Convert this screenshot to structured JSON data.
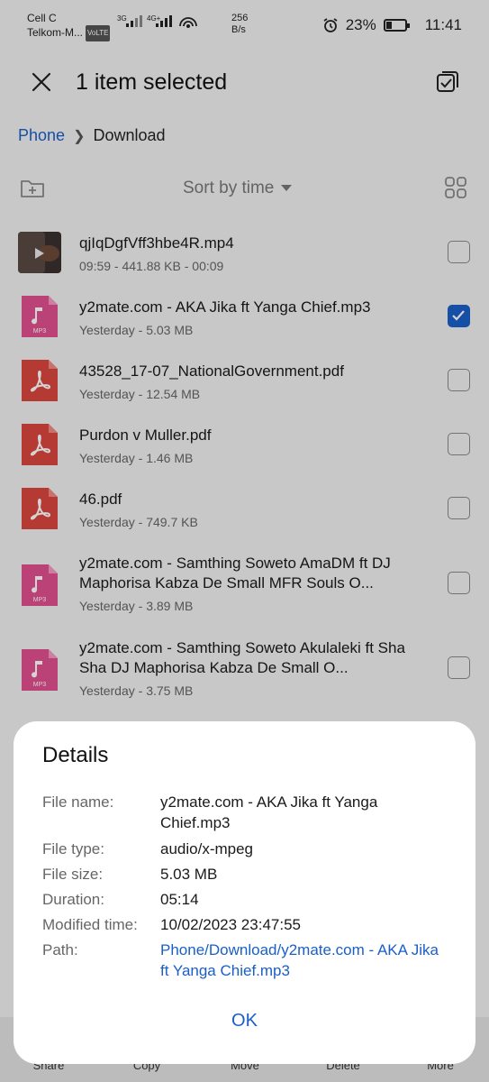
{
  "status_bar": {
    "carrier_line1": "Cell C",
    "carrier_line2": "Telkom-M...",
    "volte": "VoLTE",
    "net1": "3G",
    "net2": "4G+",
    "speed_value": "256",
    "speed_unit": "B/s",
    "battery": "23%",
    "time": "11:41"
  },
  "header": {
    "title": "1 item selected"
  },
  "breadcrumb": {
    "root": "Phone",
    "current": "Download"
  },
  "toolbar": {
    "sort_label": "Sort by time"
  },
  "files": [
    {
      "name": "qjIqDgfVff3hbe4R.mp4",
      "meta": "09:59 - 441.88 KB - 00:09",
      "type": "video",
      "checked": false
    },
    {
      "name": "y2mate.com - AKA  Jika ft Yanga Chief.mp3",
      "meta": "Yesterday - 5.03 MB",
      "type": "mp3",
      "checked": true
    },
    {
      "name": "43528_17-07_NationalGovernment.pdf",
      "meta": "Yesterday - 12.54 MB",
      "type": "pdf",
      "checked": false
    },
    {
      "name": "Purdon v Muller.pdf",
      "meta": "Yesterday - 1.46 MB",
      "type": "pdf",
      "checked": false
    },
    {
      "name": "46.pdf",
      "meta": "Yesterday - 749.7 KB",
      "type": "pdf",
      "checked": false
    },
    {
      "name": "y2mate.com - Samthing Soweto  AmaDM ft DJ Maphorisa Kabza De Small  MFR Souls O...",
      "meta": "Yesterday - 3.89 MB",
      "type": "mp3",
      "checked": false
    },
    {
      "name": "y2mate.com - Samthing Soweto  Akulaleki ft Sha Sha DJ Maphorisa  Kabza De Small O...",
      "meta": "Yesterday - 3.75 MB",
      "type": "mp3",
      "checked": false
    }
  ],
  "bottom_bar": [
    "Share",
    "Copy",
    "Move",
    "Delete",
    "More"
  ],
  "details": {
    "title": "Details",
    "rows": [
      {
        "label": "File name:",
        "value": "y2mate.com - AKA  Jika ft Yanga Chief.mp3"
      },
      {
        "label": "File type:",
        "value": "audio/x-mpeg"
      },
      {
        "label": "File size:",
        "value": "5.03 MB"
      },
      {
        "label": "Duration:",
        "value": "05:14"
      },
      {
        "label": "Modified time:",
        "value": "10/02/2023 23:47:55"
      },
      {
        "label": "Path:",
        "value": "Phone/Download/y2mate.com - AKA  Jika ft Yanga Chief.mp3"
      }
    ],
    "ok_label": "OK"
  },
  "colors": {
    "accent": "#1a5fc8",
    "pdf_icon": "#d9463e",
    "mp3_icon": "#e0508e"
  },
  "icon_labels": {
    "mp3": "MP3"
  }
}
